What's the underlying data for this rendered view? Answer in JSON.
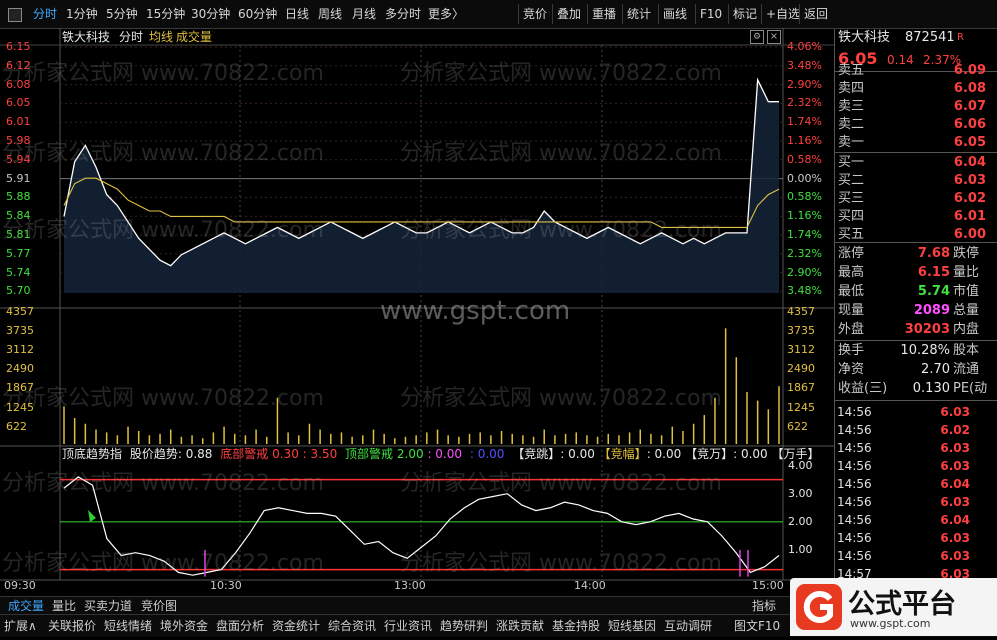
{
  "toolbar": {
    "left": [
      "分时",
      "1分钟",
      "5分钟",
      "15分钟",
      "30分钟",
      "60分钟",
      "日线",
      "周线",
      "月线",
      "多分时",
      "更多〉"
    ],
    "right": [
      "竞价",
      "叠加",
      "重播",
      "统计",
      "画线",
      "F10",
      "标记",
      "+自选",
      "返回"
    ]
  },
  "chart_header": {
    "name": "铁大科技",
    "mode": "分时",
    "avg": "均线",
    "vol": "成交量"
  },
  "price_axis": {
    "left": [
      "6.15",
      "6.12",
      "6.08",
      "6.05",
      "6.01",
      "5.98",
      "5.94",
      "5.91",
      "5.88",
      "5.84",
      "5.81",
      "5.77",
      "5.74",
      "5.70"
    ],
    "right": [
      "4.06%",
      "3.48%",
      "2.90%",
      "2.32%",
      "1.74%",
      "1.16%",
      "0.58%",
      "0.00%",
      "0.58%",
      "1.16%",
      "1.74%",
      "2.32%",
      "2.90%",
      "3.48%"
    ]
  },
  "volume_axis": [
    "4357",
    "3735",
    "3112",
    "2490",
    "1867",
    "1245",
    "622"
  ],
  "time_axis": [
    "09:30",
    "10:30",
    "13:00",
    "14:00",
    "15:00"
  ],
  "watermark_site": "www.gspt.com",
  "watermark_text": "分析家公式网 www.70822.com",
  "indicator": {
    "name": "顶底趋势指",
    "trend_label": "股价趋势:",
    "trend_value": "0.88",
    "bottom_label": "底部警戒",
    "bottom_values": "0.30 : 3.50",
    "top_label": "顶部警戒",
    "top_value": "2.00",
    "v1": ": 0.00",
    "v2": ": 0.00",
    "jt": "【竞跳】",
    "jt_val": ": 0.00",
    "jf": "【竞幅】",
    "jf_val": ": 0.00",
    "jw": "【竞万】",
    "jw_val": ": 0.00",
    "ws": "【万手】",
    "axis": [
      "4.00",
      "3.00",
      "2.00",
      "1.00"
    ]
  },
  "quote": {
    "name": "铁大科技",
    "code": "872541",
    "badge": "R",
    "price": "6.05",
    "change": "0.14",
    "pct": "2.37%",
    "asks": [
      {
        "k": "卖五",
        "v": "6.09"
      },
      {
        "k": "卖四",
        "v": "6.08"
      },
      {
        "k": "卖三",
        "v": "6.07"
      },
      {
        "k": "卖二",
        "v": "6.06"
      },
      {
        "k": "卖一",
        "v": "6.05"
      }
    ],
    "bids": [
      {
        "k": "买一",
        "v": "6.04"
      },
      {
        "k": "买二",
        "v": "6.03"
      },
      {
        "k": "买三",
        "v": "6.02"
      },
      {
        "k": "买四",
        "v": "6.01"
      },
      {
        "k": "买五",
        "v": "6.00"
      }
    ],
    "stats": [
      {
        "k": "涨停",
        "v": "7.68",
        "k2": "跌停",
        "c": "#ff4040"
      },
      {
        "k": "最高",
        "v": "6.15",
        "k2": "量比",
        "c": "#ff4040"
      },
      {
        "k": "最低",
        "v": "5.74",
        "k2": "市值",
        "c": "#40e040"
      },
      {
        "k": "现量",
        "v": "2089",
        "k2": "总量",
        "c": "#ff50ff"
      },
      {
        "k": "外盘",
        "v": "30203",
        "k2": "内盘",
        "c": "#ff4040"
      }
    ],
    "stats2": [
      {
        "k": "换手",
        "v": "10.28%",
        "k2": "股本"
      },
      {
        "k": "净资",
        "v": "2.70",
        "k2": "流通"
      },
      {
        "k": "收益(三)",
        "v": "0.130",
        "k2": "PE(动"
      }
    ],
    "trades": [
      {
        "t": "14:56",
        "p": "6.03"
      },
      {
        "t": "14:56",
        "p": "6.02"
      },
      {
        "t": "14:56",
        "p": "6.03"
      },
      {
        "t": "14:56",
        "p": "6.03"
      },
      {
        "t": "14:56",
        "p": "6.04"
      },
      {
        "t": "14:56",
        "p": "6.03"
      },
      {
        "t": "14:56",
        "p": "6.04"
      },
      {
        "t": "14:56",
        "p": "6.03"
      },
      {
        "t": "14:56",
        "p": "6.03"
      },
      {
        "t": "14:57",
        "p": "6.03"
      }
    ]
  },
  "bottom_tabs1": [
    "成交量",
    "量比",
    "买卖力道",
    "竞价图"
  ],
  "bottom_tabs1_right": "指标",
  "bottom_tabs2": [
    "扩展∧",
    "关联报价",
    "短线情绪",
    "境外资金",
    "盘面分析",
    "资金统计",
    "综合资讯",
    "行业资讯",
    "趋势研判",
    "涨跌贡献",
    "基金持股",
    "短线基因",
    "互动调研",
    "图文F10"
  ],
  "logo_text": "公式平台",
  "logo_url": "www.gspt.com",
  "colors": {
    "up": "#ff4040",
    "down": "#40e040",
    "price_line": "#ffffff",
    "avg_line": "#e0c040",
    "vol": "#e0c040",
    "accent": "#3fa8ff"
  },
  "chart_data": {
    "type": "line",
    "price_range": [
      5.7,
      6.15
    ],
    "price_series": [
      5.84,
      5.94,
      5.97,
      5.93,
      5.88,
      5.86,
      5.83,
      5.8,
      5.78,
      5.76,
      5.75,
      5.77,
      5.78,
      5.79,
      5.8,
      5.81,
      5.8,
      5.79,
      5.8,
      5.81,
      5.82,
      5.81,
      5.8,
      5.81,
      5.82,
      5.83,
      5.82,
      5.81,
      5.8,
      5.81,
      5.82,
      5.83,
      5.82,
      5.81,
      5.81,
      5.82,
      5.83,
      5.82,
      5.81,
      5.82,
      5.83,
      5.82,
      5.81,
      5.81,
      5.82,
      5.85,
      5.83,
      5.82,
      5.81,
      5.8,
      5.81,
      5.82,
      5.81,
      5.8,
      5.79,
      5.8,
      5.81,
      5.8,
      5.79,
      5.8,
      5.79,
      5.8,
      5.81,
      5.81,
      5.81,
      6.09,
      6.05,
      6.05
    ],
    "avg_series": [
      5.86,
      5.9,
      5.91,
      5.91,
      5.9,
      5.89,
      5.87,
      5.86,
      5.85,
      5.85,
      5.84,
      5.84,
      5.84,
      5.84,
      5.84,
      5.84,
      5.83,
      5.83,
      5.83,
      5.83,
      5.83,
      5.83,
      5.83,
      5.83,
      5.83,
      5.83,
      5.83,
      5.83,
      5.83,
      5.83,
      5.83,
      5.83,
      5.83,
      5.83,
      5.83,
      5.83,
      5.83,
      5.83,
      5.83,
      5.83,
      5.83,
      5.83,
      5.83,
      5.83,
      5.83,
      5.83,
      5.83,
      5.83,
      5.83,
      5.83,
      5.83,
      5.83,
      5.83,
      5.83,
      5.83,
      5.83,
      5.82,
      5.82,
      5.82,
      5.82,
      5.82,
      5.82,
      5.82,
      5.82,
      5.82,
      5.86,
      5.88,
      5.89
    ],
    "volume_range": [
      0,
      4357
    ],
    "volume_series": [
      1300,
      900,
      700,
      500,
      400,
      300,
      600,
      450,
      300,
      350,
      500,
      250,
      300,
      200,
      400,
      600,
      350,
      300,
      500,
      250,
      1600,
      400,
      300,
      700,
      500,
      350,
      400,
      250,
      300,
      500,
      350,
      200,
      250,
      300,
      400,
      500,
      300,
      250,
      350,
      400,
      300,
      450,
      350,
      300,
      250,
      500,
      300,
      350,
      400,
      300,
      250,
      350,
      300,
      400,
      500,
      350,
      300,
      600,
      450,
      700,
      1000,
      1600,
      4000,
      3000,
      1800,
      1500,
      1200,
      2000
    ],
    "indicator_range": [
      0,
      4.2
    ],
    "indicator_series": [
      3.2,
      3.6,
      3.3,
      1.4,
      0.8,
      0.9,
      0.8,
      0.6,
      0.2,
      0.1,
      0.2,
      0.3,
      0.9,
      1.6,
      2.4,
      2.5,
      2.4,
      2.3,
      2.3,
      2.2,
      1.7,
      1.2,
      1.3,
      0.9,
      0.7,
      1.1,
      1.5,
      2.1,
      2.5,
      2.8,
      2.9,
      3.0,
      2.6,
      2.4,
      2.5,
      2.7,
      2.6,
      2.4,
      2.3,
      2.0,
      1.9,
      2.0,
      2.2,
      2.3,
      2.1,
      2.0,
      1.5,
      0.9,
      0.2,
      0.4,
      0.8
    ]
  }
}
